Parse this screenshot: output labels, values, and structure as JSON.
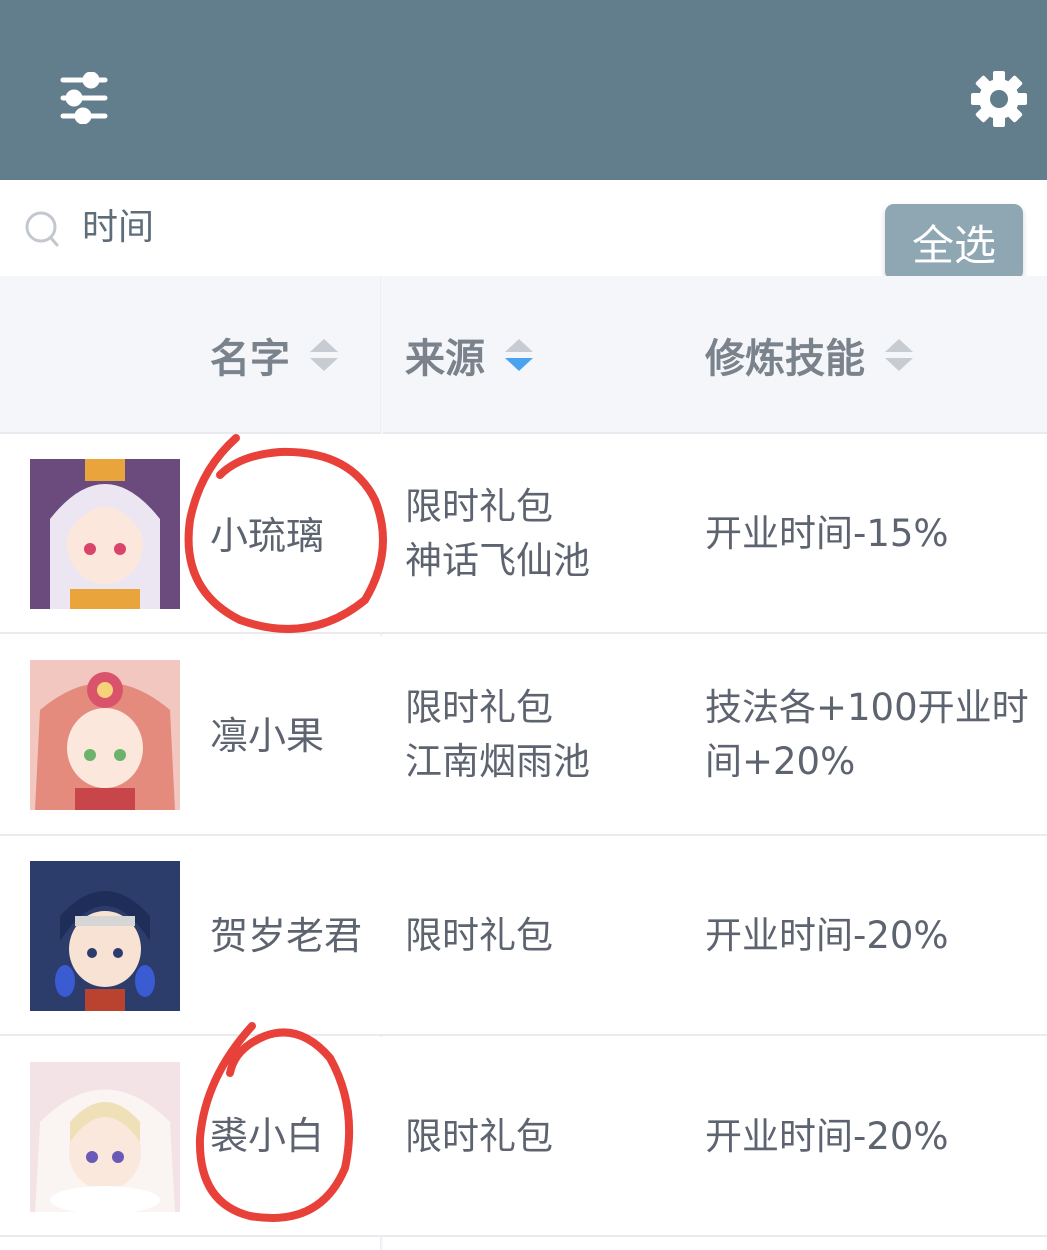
{
  "toolbar": {
    "filter_icon": "sliders-icon",
    "settings_icon": "gear-icon",
    "background": "#627d8b"
  },
  "search": {
    "icon": "search-icon",
    "value": "时间"
  },
  "select_all_label": "全选",
  "columns": {
    "name": "名字",
    "source": "来源",
    "skill": "修炼技能",
    "active_sort_color": "#4aa3f0"
  },
  "rows": [
    {
      "name": "小琉璃",
      "source_line1": "限时礼包",
      "source_line2": "神话飞仙池",
      "skill_line1": "开业时间-15%",
      "skill_line2": ""
    },
    {
      "name": "凛小果",
      "source_line1": "限时礼包",
      "source_line2": "江南烟雨池",
      "skill_line1": "技法各+100开业时",
      "skill_line2": "间+20%"
    },
    {
      "name": "贺岁老君",
      "source_line1": "限时礼包",
      "source_line2": "",
      "skill_line1": "开业时间-20%",
      "skill_line2": ""
    },
    {
      "name": "裘小白",
      "source_line1": "限时礼包",
      "source_line2": "",
      "skill_line1": "开业时间-20%",
      "skill_line2": ""
    }
  ],
  "annotation_color": "#e8413a"
}
